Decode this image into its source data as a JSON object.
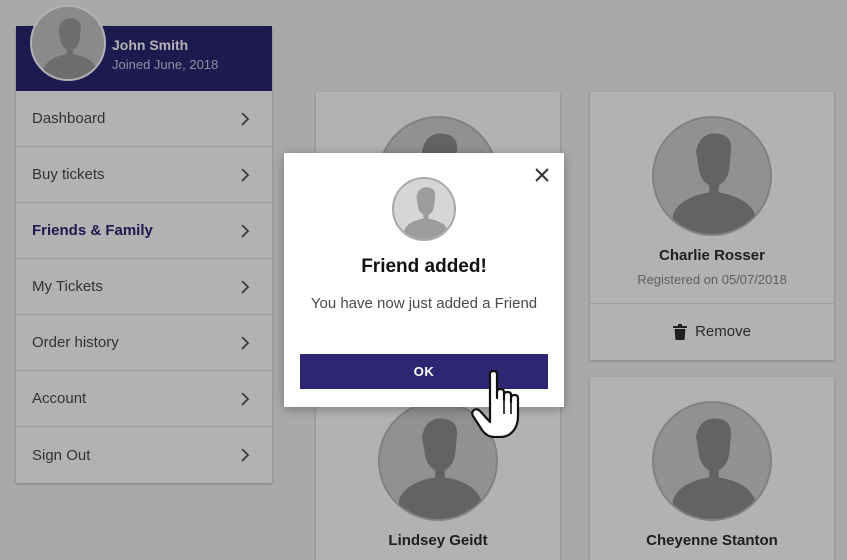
{
  "user": {
    "name": "John Smith",
    "joined": "Joined June, 2018"
  },
  "menu": [
    {
      "label": "Dashboard",
      "active": false
    },
    {
      "label": "Buy tickets",
      "active": false
    },
    {
      "label": "Friends & Family",
      "active": true
    },
    {
      "label": "My Tickets",
      "active": false
    },
    {
      "label": "Order history",
      "active": false
    },
    {
      "label": "Account",
      "active": false
    },
    {
      "label": "Sign Out",
      "active": false
    }
  ],
  "friends": [
    {
      "name": "Charlie Rosser",
      "registered": "Registered on 05/07/2018",
      "action": "Remove"
    },
    {
      "name": "Lindsey Geidt"
    },
    {
      "name": "Cheyenne Stanton"
    }
  ],
  "modal": {
    "title": "Friend added!",
    "message": "You have now just added a Friend",
    "ok_label": "OK"
  },
  "colors": {
    "brand": "#2c2673",
    "overlay": "rgba(0,0,0,0.30)"
  },
  "icons": {
    "menu_chevron": "chevron-right-icon",
    "remove": "trash-icon",
    "close": "close-icon",
    "cursor": "hand-pointer-icon"
  }
}
